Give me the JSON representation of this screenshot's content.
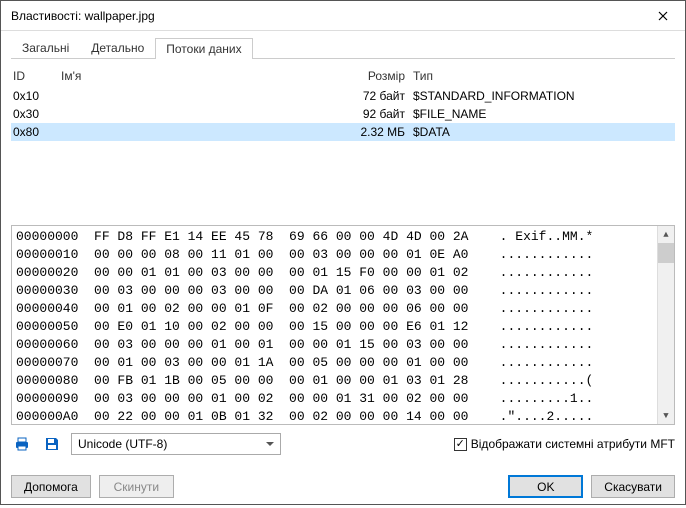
{
  "window": {
    "title": "Властивості: wallpaper.jpg"
  },
  "tabs": {
    "general": "Загальні",
    "details": "Детально",
    "streams": "Потоки даних"
  },
  "columns": {
    "id": "ID",
    "name": "Ім'я",
    "size": "Розмір",
    "type": "Тип"
  },
  "rows": [
    {
      "id": "0x10",
      "name": "",
      "size": "72 байт",
      "type": "$STANDARD_INFORMATION",
      "selected": false
    },
    {
      "id": "0x30",
      "name": "",
      "size": "92 байт",
      "type": "$FILE_NAME",
      "selected": false
    },
    {
      "id": "0x80",
      "name": "",
      "size": "2.32 МБ",
      "type": "$DATA",
      "selected": true
    }
  ],
  "hex": [
    {
      "addr": "00000000",
      "b": "FF D8 FF E1 14 EE 45 78  69 66 00 00 4D 4D 00 2A",
      "a": ". Exif..MM.*"
    },
    {
      "addr": "00000010",
      "b": "00 00 00 08 00 11 01 00  00 03 00 00 00 01 0E A0",
      "a": "............"
    },
    {
      "addr": "00000020",
      "b": "00 00 01 01 00 03 00 00  00 01 15 F0 00 00 01 02",
      "a": "............"
    },
    {
      "addr": "00000030",
      "b": "00 03 00 00 00 03 00 00  00 DA 01 06 00 03 00 00",
      "a": "............"
    },
    {
      "addr": "00000040",
      "b": "00 01 00 02 00 00 01 0F  00 02 00 00 00 06 00 00",
      "a": "............"
    },
    {
      "addr": "00000050",
      "b": "00 E0 01 10 00 02 00 00  00 15 00 00 00 E6 01 12",
      "a": "............"
    },
    {
      "addr": "00000060",
      "b": "00 03 00 00 00 01 00 01  00 00 01 15 00 03 00 00",
      "a": "............"
    },
    {
      "addr": "00000070",
      "b": "00 01 00 03 00 00 01 1A  00 05 00 00 00 01 00 00",
      "a": "............"
    },
    {
      "addr": "00000080",
      "b": "00 FB 01 1B 00 05 00 00  00 01 00 00 01 03 01 28",
      "a": "...........("
    },
    {
      "addr": "00000090",
      "b": "00 03 00 00 00 01 00 02  00 00 01 31 00 02 00 00",
      "a": ".........1.."
    },
    {
      "addr": "000000A0",
      "b": "00 22 00 00 01 0B 01 32  00 02 00 00 00 14 00 00",
      "a": ".\"....2....."
    }
  ],
  "encoding": {
    "value": "Unicode (UTF-8)"
  },
  "checkbox": {
    "label": "Відображати системні атрибути MFT",
    "checked": true
  },
  "buttons": {
    "help": "Допомога",
    "reset": "Скинути",
    "ok": "OK",
    "cancel": "Скасувати"
  }
}
